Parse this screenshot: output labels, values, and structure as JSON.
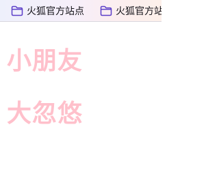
{
  "bookmarks_bar": {
    "items": [
      {
        "label": "火狐官方站点",
        "icon": "folder-icon"
      },
      {
        "label": "火狐官方站点",
        "icon": "folder-icon"
      }
    ],
    "folder_icon_color": "#5b3ec8"
  },
  "content": {
    "lines": [
      "小朋友",
      "大忽悠"
    ],
    "text_color": "#ffc0cb"
  }
}
